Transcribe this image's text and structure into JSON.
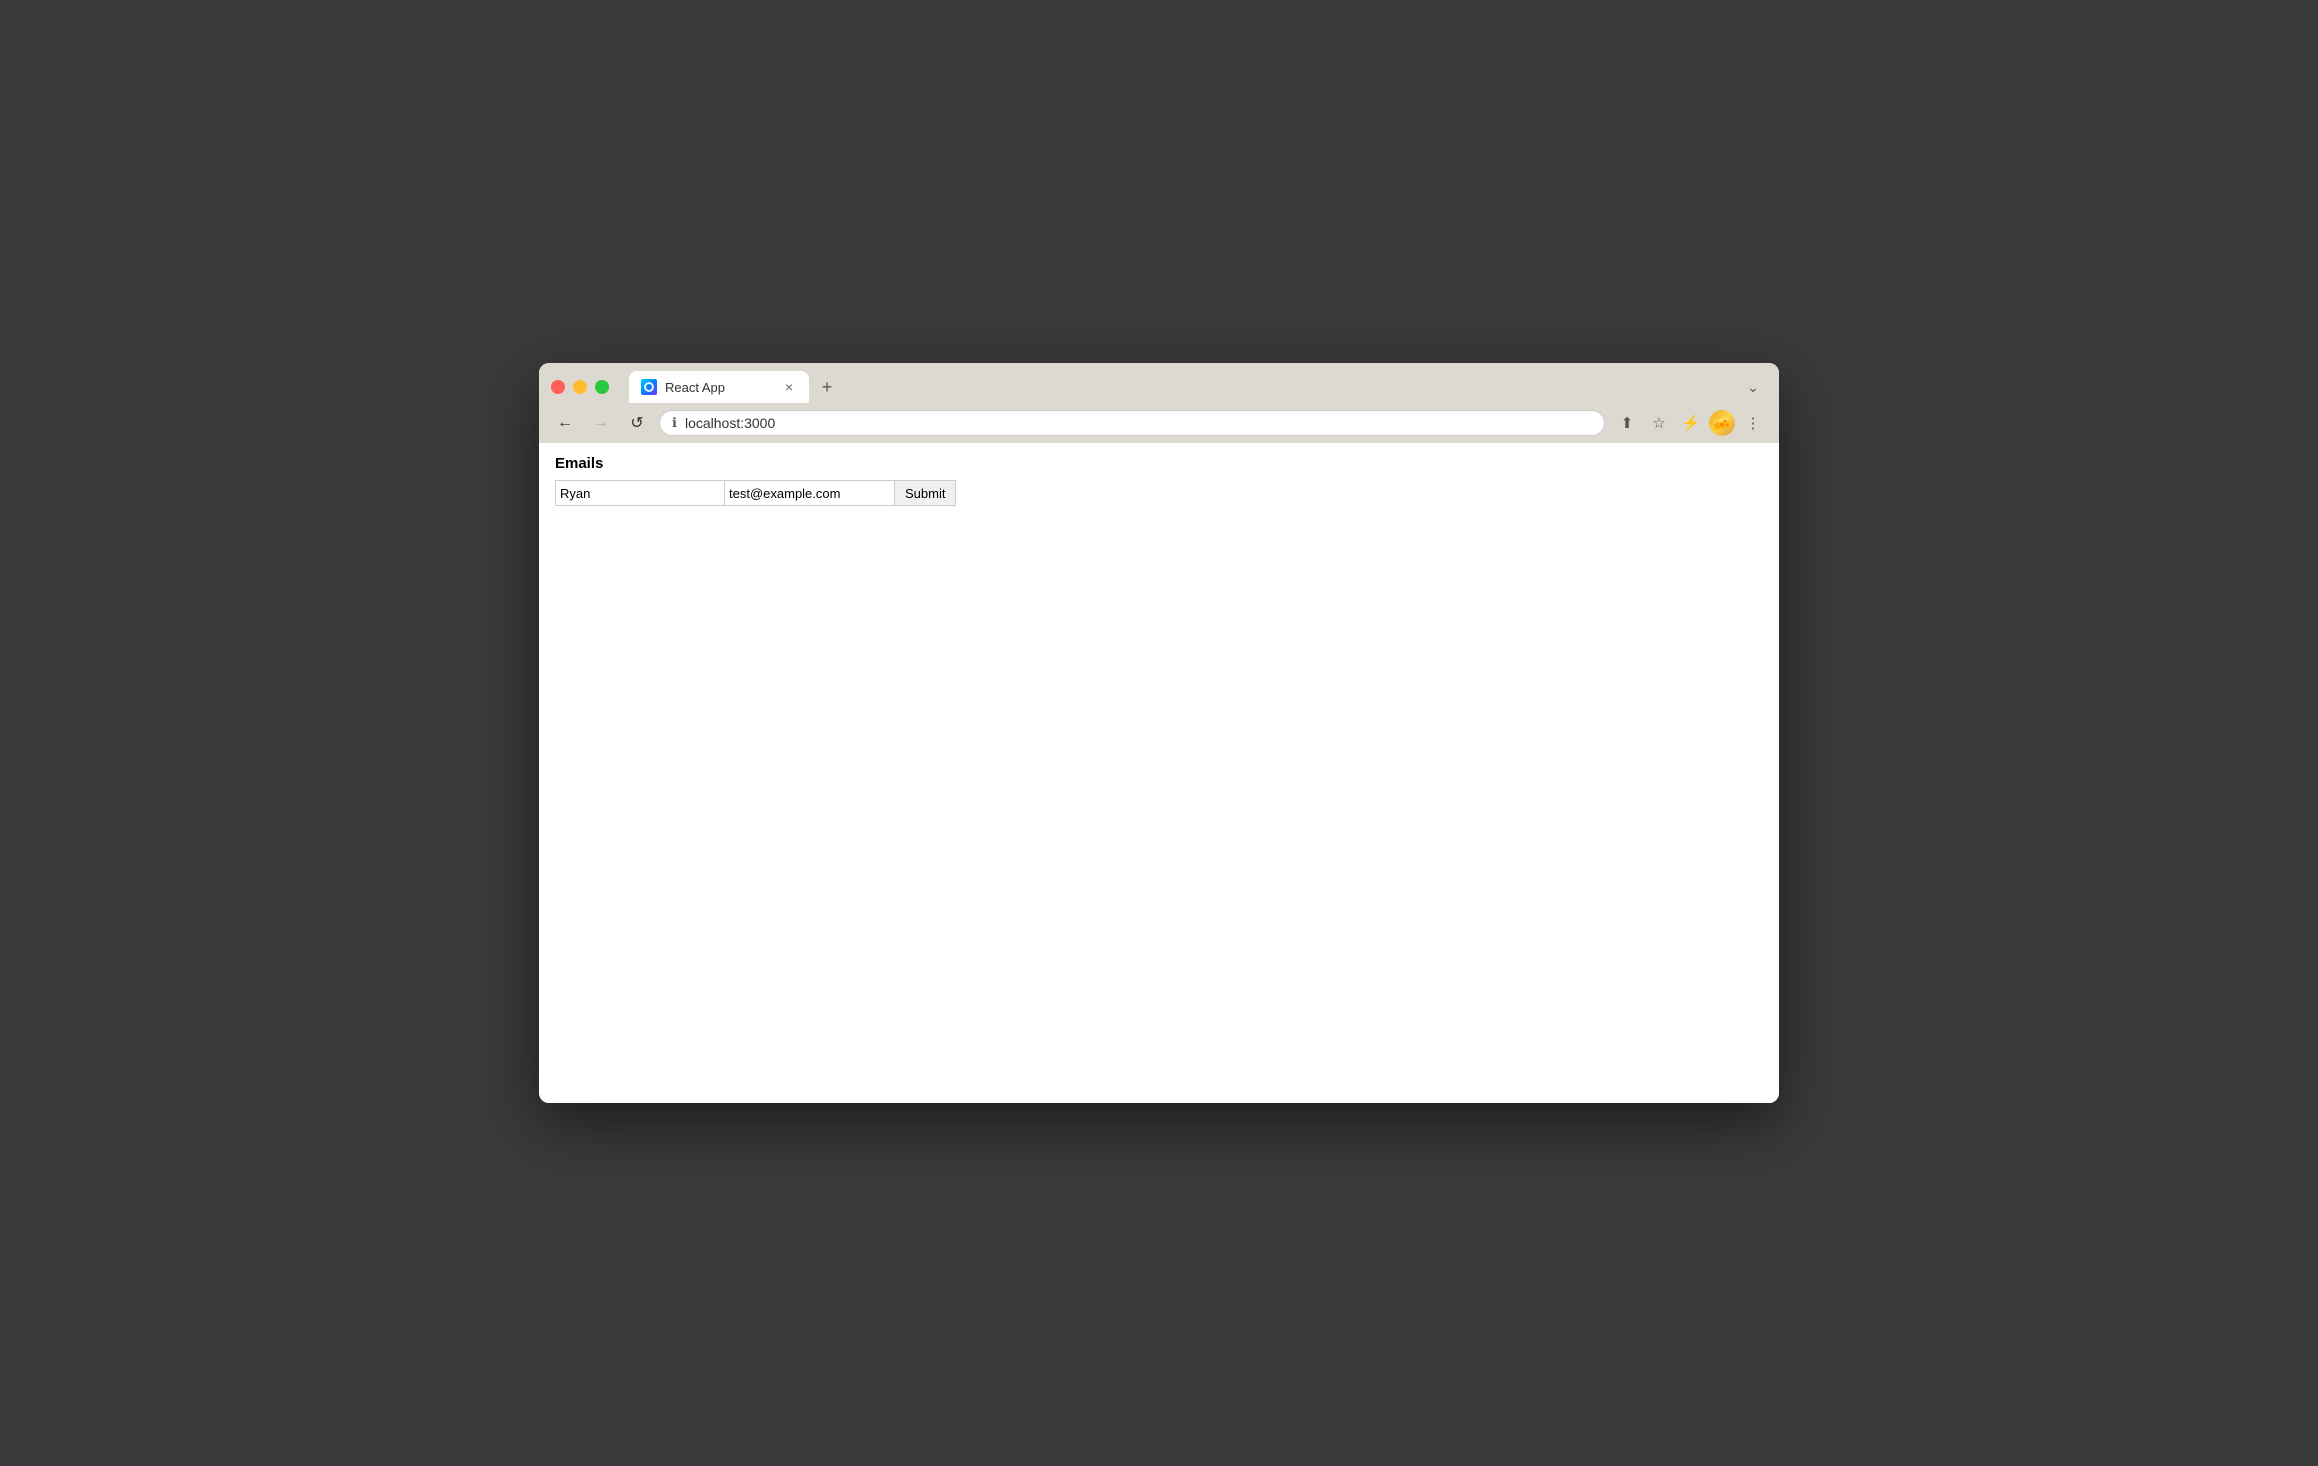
{
  "browser": {
    "tab": {
      "title": "React App",
      "favicon_alt": "react-favicon"
    },
    "tab_close_label": "×",
    "new_tab_label": "+",
    "tab_list_label": "⌄",
    "nav": {
      "back_label": "←",
      "forward_label": "→",
      "reload_label": "↺",
      "address": "localhost:3000",
      "address_placeholder": "localhost:3000",
      "share_label": "⬆",
      "bookmark_label": "☆",
      "extensions_label": "⚡",
      "menu_label": "⋮"
    }
  },
  "page": {
    "heading": "Emails",
    "form": {
      "name_value": "Ryan",
      "name_placeholder": "",
      "email_value": "test@example.com",
      "email_placeholder": "",
      "submit_label": "Submit"
    }
  }
}
